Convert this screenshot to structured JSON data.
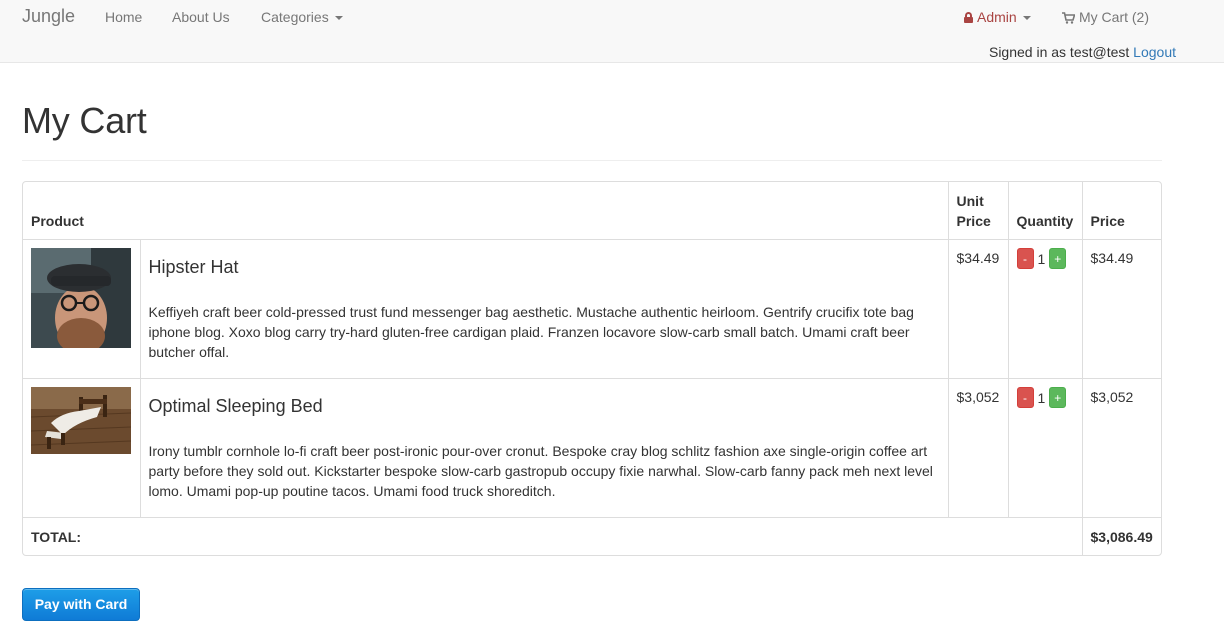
{
  "navbar": {
    "brand": "Jungle",
    "links": [
      "Home",
      "About Us",
      "Categories"
    ],
    "admin_label": "Admin",
    "cart_label": "My Cart (2)",
    "signed_in_text": "Signed in as test@test",
    "logout_label": "Logout"
  },
  "page": {
    "title": "My Cart"
  },
  "table": {
    "headers": [
      "Product",
      "Unit Price",
      "Quantity",
      "Price"
    ],
    "items": [
      {
        "name": "Hipster Hat",
        "description": "Keffiyeh craft beer cold-pressed trust fund messenger bag aesthetic. Mustache authentic heirloom. Gentrify crucifix tote bag iphone blog. Xoxo blog carry try-hard gluten-free cardigan plaid. Franzen locavore slow-carb small batch. Umami craft beer butcher offal.",
        "unit_price": "$34.49",
        "quantity": "1",
        "price": "$34.49"
      },
      {
        "name": "Optimal Sleeping Bed",
        "description": "Irony tumblr cornhole lo-fi craft beer post-ironic pour-over cronut. Bespoke cray blog schlitz fashion axe single-origin coffee art party before they sold out. Kickstarter bespoke slow-carb gastropub occupy fixie narwhal. Slow-carb fanny pack meh next level lomo. Umami pop-up poutine tacos. Umami food truck shoreditch.",
        "unit_price": "$3,052",
        "quantity": "1",
        "price": "$3,052"
      }
    ],
    "minus_label": "-",
    "plus_label": "+",
    "total_label": "TOTAL:",
    "total_value": "$3,086.49"
  },
  "pay_button_label": "Pay with Card",
  "colors": {
    "admin": "#a94442",
    "link": "#337ab7",
    "minus": "#d9534f",
    "plus": "#5cb85c",
    "pay_button": "#1689e0"
  }
}
